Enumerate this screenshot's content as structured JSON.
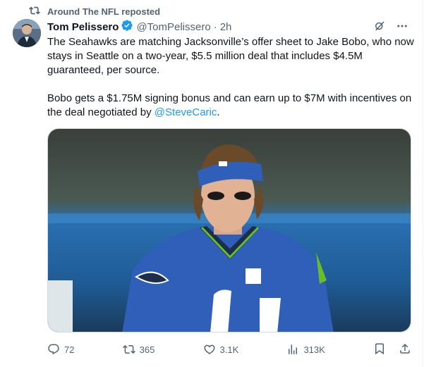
{
  "repost": {
    "label": "Around The NFL reposted"
  },
  "author": {
    "name": "Tom Pelissero",
    "handle": "@TomPelissero",
    "time": "2h"
  },
  "tweet": {
    "para1": "The Seahawks are matching Jacksonville’s offer sheet to Jake Bobo, who now stays in Seattle on a two-year, $5.5 million deal that includes $4.5M guaranteed, per source.",
    "para2_before": "Bobo gets a $1.75M signing bonus and can earn up to $7M with incentives on the deal negotiated by ",
    "mention": "@SteveCaric",
    "para2_after": "."
  },
  "metrics": {
    "replies": "72",
    "reposts": "365",
    "likes": "3.1K",
    "views": "313K"
  },
  "colors": {
    "accent": "#1d9bf0",
    "muted": "#536471",
    "jersey": "#2f5fb8"
  }
}
